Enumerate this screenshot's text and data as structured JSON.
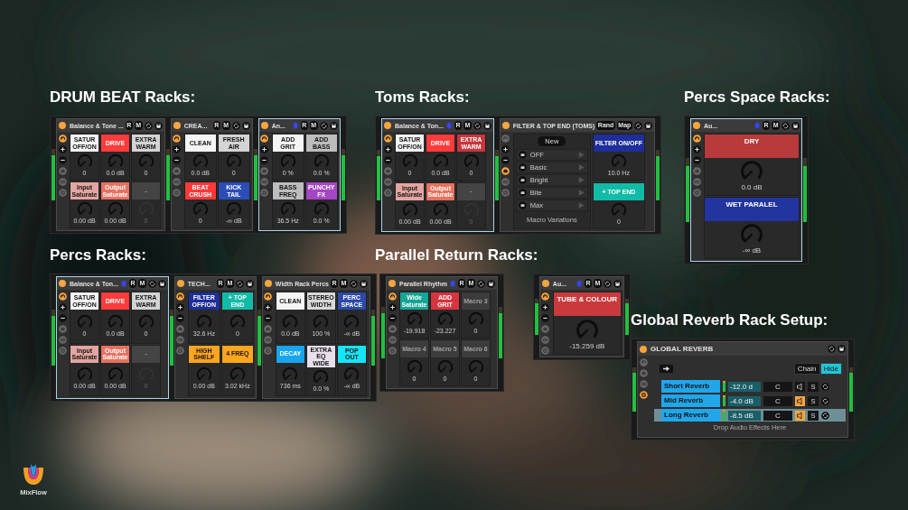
{
  "sections": [
    {
      "title": "DRUM BEAT Racks:",
      "frames": [
        {
          "racks": [
            {
              "kind": "macros",
              "title": "Balance & Tone ...",
              "selected": false,
              "mapping": false,
              "header_buttons": [
                "R",
                "M"
              ],
              "macros": [
                {
                  "name": "SATUR OFF/ON",
                  "color": "#f4f4f4",
                  "reading": "0"
                },
                {
                  "name": "DRIVE",
                  "color": "#ff3b3b",
                  "reading": "0.0 dB"
                },
                {
                  "name": "EXTRA WARM",
                  "color": "#d4d4d4",
                  "reading": "0"
                },
                {
                  "name": "Input Saturate",
                  "color": "#e3a5a0",
                  "reading": "0.00 dB"
                },
                {
                  "name": "Output Saturate",
                  "color": "#e8705f",
                  "reading": "0.00 dB"
                },
                {
                  "name": "-",
                  "color": "#444444",
                  "reading": "0",
                  "disabled": true
                }
              ]
            },
            {
              "kind": "macros",
              "title": "CREA...",
              "selected": false,
              "mapping": false,
              "header_buttons": [
                "R",
                "M"
              ],
              "macros": [
                {
                  "name": "CLEAN",
                  "color": "#f4f4f4",
                  "reading": "0.0 dB"
                },
                {
                  "name": "FRESH AIR",
                  "color": "#d4d4d4",
                  "reading": "0"
                },
                {
                  "name": "BEAT CRUSH",
                  "color": "#ff3838",
                  "reading": "0"
                },
                {
                  "name": "KICK TAIL",
                  "color": "#2c4db8",
                  "reading": "-∞ dB"
                }
              ]
            },
            {
              "kind": "macros",
              "title": "An...",
              "selected": true,
              "mapping": true,
              "header_buttons": [
                "R",
                "M"
              ],
              "macros": [
                {
                  "name": "ADD GRIT",
                  "color": "#f4f4f4",
                  "reading": "0 %"
                },
                {
                  "name": "ADD BASS",
                  "color": "#bdbdbd",
                  "reading": "0.0 %"
                },
                {
                  "name": "BASS FREQ",
                  "color": "#bdbdbd",
                  "reading": "36.5 Hz"
                },
                {
                  "name": "PUNCHY FX",
                  "color": "#a546c4",
                  "reading": "0.0 %"
                }
              ]
            }
          ]
        }
      ]
    },
    {
      "title": "Toms Racks:",
      "frames": [
        {
          "racks": [
            {
              "kind": "macros",
              "title": "Balance & Ton...",
              "selected": true,
              "mapping": true,
              "header_buttons": [
                "R",
                "M"
              ],
              "macros": [
                {
                  "name": "SATUR OFF/ON",
                  "color": "#f4f4f4",
                  "reading": "0"
                },
                {
                  "name": "DRIVE",
                  "color": "#ff3b3b",
                  "reading": "0.0 dB"
                },
                {
                  "name": "EXTRA WARM",
                  "color": "#c8363c",
                  "reading": "0"
                },
                {
                  "name": "Input Saturate",
                  "color": "#e3a5a0",
                  "reading": "0.00 dB"
                },
                {
                  "name": "Output Saturate",
                  "color": "#e8705f",
                  "reading": "0.00 dB"
                },
                {
                  "name": "-",
                  "color": "#444444",
                  "reading": "0",
                  "disabled": true
                }
              ]
            },
            {
              "kind": "variations",
              "title": "FILTER & TOP END (TOMS)",
              "selected": false,
              "mapping": false,
              "header_buttons": [
                "Rand",
                "Map"
              ],
              "new_button": "New",
              "variations": [
                "OFF",
                "Basic",
                "Bright",
                "Bite",
                "Max"
              ],
              "variations_label": "Macro Variations",
              "macros": [
                {
                  "name": "FILTER ON/OFF",
                  "color": "#1e2e9a",
                  "reading": "10.0 Hz"
                },
                {
                  "name": "+ TOP END",
                  "color": "#12bba7",
                  "reading": "0"
                }
              ]
            }
          ]
        }
      ]
    },
    {
      "title": "Percs Space Racks:",
      "frames": [
        {
          "racks": [
            {
              "kind": "macros",
              "title": "Au...",
              "selected": true,
              "mapping": true,
              "header_buttons": [
                "R",
                "M"
              ],
              "macros": [
                {
                  "name": "DRY",
                  "color": "#b83a3a",
                  "reading": "0.0 dB"
                },
                {
                  "name": "WET PARALEL",
                  "color": "#2234a0",
                  "reading": "-∞ dB"
                }
              ]
            }
          ]
        }
      ]
    },
    {
      "title": "Percs Racks:",
      "frames": [
        {
          "racks": [
            {
              "kind": "macros",
              "title": "Balance & Ton...",
              "selected": true,
              "mapping": true,
              "header_buttons": [
                "R",
                "M"
              ],
              "macros": [
                {
                  "name": "SATUR OFF/ON",
                  "color": "#f4f4f4",
                  "reading": "0"
                },
                {
                  "name": "DRIVE",
                  "color": "#ff3b3b",
                  "reading": "0.0 dB"
                },
                {
                  "name": "EXTRA WARM",
                  "color": "#d4d4d4",
                  "reading": "0"
                },
                {
                  "name": "Input Saturate",
                  "color": "#e3a5a0",
                  "reading": "0.00 dB"
                },
                {
                  "name": "Output Saturate",
                  "color": "#e8705f",
                  "reading": "0.00 dB"
                },
                {
                  "name": "-",
                  "color": "#444444",
                  "reading": "0",
                  "disabled": true
                }
              ]
            },
            {
              "kind": "macros",
              "title": "TECH...",
              "selected": false,
              "mapping": false,
              "header_buttons": [
                "R",
                "M"
              ],
              "macros": [
                {
                  "name": "FILTER OFF/ON",
                  "color": "#1e2e9a",
                  "reading": "32.6 Hz"
                },
                {
                  "name": "+ TOP END",
                  "color": "#12bba7",
                  "reading": "0"
                },
                {
                  "name": "HIGH SHELF",
                  "color": "#ffa51e",
                  "reading": "0.00 dB"
                },
                {
                  "name": "4 FREQ",
                  "color": "#ffa51e",
                  "reading": "3.02 kHz"
                }
              ]
            },
            {
              "kind": "macros",
              "title": "Width Rack Percs",
              "selected": false,
              "mapping": false,
              "header_buttons": [
                "R",
                "M"
              ],
              "macros": [
                {
                  "name": "CLEAN",
                  "color": "#f4f4f4",
                  "reading": "0.0 dB"
                },
                {
                  "name": "STEREO WIDTH",
                  "color": "#d8d8d8",
                  "reading": "100 %"
                },
                {
                  "name": "PERC SPACE",
                  "color": "#2c4aa8",
                  "reading": "-∞ dB"
                },
                {
                  "name": "DECAY",
                  "color": "#17a5ef",
                  "reading": "736 ms"
                },
                {
                  "name": "EXTRA EQ WIDE",
                  "color": "#e8e0ec",
                  "reading": "0.0 %"
                },
                {
                  "name": "POP OUT",
                  "color": "#14e6f8",
                  "reading": "-∞ dB"
                }
              ]
            }
          ]
        }
      ]
    },
    {
      "title": "Parallel Return Racks:",
      "frames": [
        {
          "racks": [
            {
              "kind": "macros",
              "title": "Parallel Rhythm",
              "selected": false,
              "mapping": true,
              "header_buttons": [
                "R",
                "M"
              ],
              "macros": [
                {
                  "name": "Wide Saturate",
                  "color": "#17a595",
                  "reading": "-19.918"
                },
                {
                  "name": "ADD GRIT",
                  "color": "#d8343f",
                  "reading": "-23.227"
                },
                {
                  "name": "Macro 3",
                  "color": "#3c3c3c",
                  "reading": "0"
                },
                {
                  "name": "Macro 4",
                  "color": "#3c3c3c",
                  "reading": "0"
                },
                {
                  "name": "Macro 5",
                  "color": "#3c3c3c",
                  "reading": "0"
                },
                {
                  "name": "Macro 6",
                  "color": "#3c3c3c",
                  "reading": "0"
                }
              ]
            }
          ]
        },
        {
          "racks": [
            {
              "kind": "macros",
              "title": "Au...",
              "selected": false,
              "mapping": true,
              "header_buttons": [
                "R",
                "M"
              ],
              "macros": [
                {
                  "name": "TUBE & COLOUR",
                  "color": "#c83a3c",
                  "reading": "-15.259 dB"
                }
              ]
            }
          ]
        }
      ]
    },
    {
      "title": "Global Reverb Rack Setup:",
      "frames": [
        {
          "racks": [
            {
              "kind": "chains",
              "title": "GLOBAL REVERB",
              "selected": false,
              "mapping": false,
              "view_buttons": [
                {
                  "label": "Chain",
                  "selected": false
                },
                {
                  "label": "Hide",
                  "selected": true
                }
              ],
              "chains": [
                {
                  "name": "Short Reverb",
                  "volume": "-12.0 d",
                  "pan": "C",
                  "active": false,
                  "solo": "S",
                  "selected": false
                },
                {
                  "name": "Mid Reverb",
                  "volume": "-4.0 dB",
                  "pan": "C",
                  "active": true,
                  "solo": "S",
                  "selected": false
                },
                {
                  "name": "Long Reverb",
                  "volume": "-8.5 dB",
                  "pan": "C",
                  "active": true,
                  "solo": "S",
                  "selected": true
                }
              ],
              "drop_hint": "Drop Audio Effects Here"
            }
          ]
        }
      ]
    }
  ],
  "logo": {
    "text": "MixFlow"
  }
}
